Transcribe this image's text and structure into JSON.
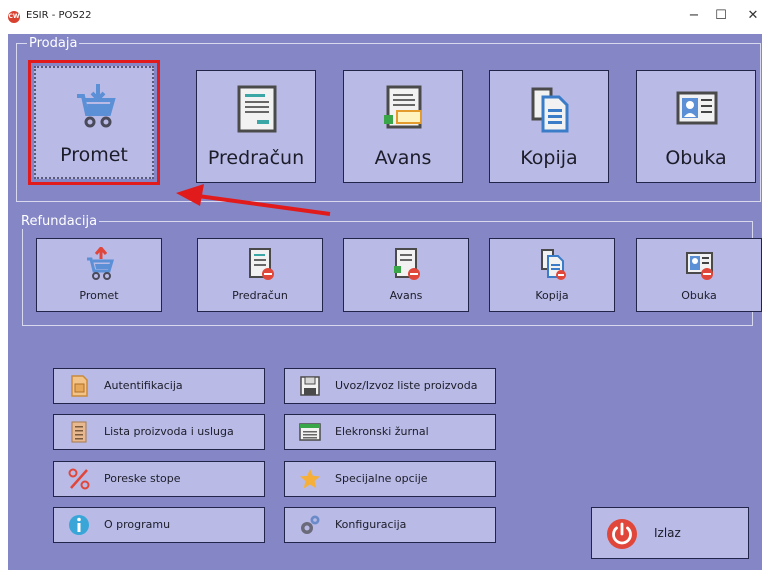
{
  "window": {
    "title": "ESIR - POS22",
    "logo_text": "CW",
    "minimize": "−",
    "maximize": "☐",
    "close": "✕"
  },
  "prodaja": {
    "legend": "Prodaja",
    "buttons": [
      {
        "label": "Promet",
        "icon": "cart-icon"
      },
      {
        "label": "Predračun",
        "icon": "invoice-icon"
      },
      {
        "label": "Avans",
        "icon": "advance-icon"
      },
      {
        "label": "Kopija",
        "icon": "copy-icon"
      },
      {
        "label": "Obuka",
        "icon": "training-icon"
      }
    ]
  },
  "refundacija": {
    "legend": "Refundacija",
    "buttons": [
      {
        "label": "Promet",
        "icon": "cart-refund-icon"
      },
      {
        "label": "Predračun",
        "icon": "invoice-refund-icon"
      },
      {
        "label": "Avans",
        "icon": "advance-refund-icon"
      },
      {
        "label": "Kopija",
        "icon": "copy-refund-icon"
      },
      {
        "label": "Obuka",
        "icon": "training-refund-icon"
      }
    ]
  },
  "options": {
    "left": [
      {
        "label": "Autentifikacija",
        "icon": "sim-card-icon"
      },
      {
        "label": "Lista proizvoda i usluga",
        "icon": "list-icon"
      },
      {
        "label": "Poreske stope",
        "icon": "percent-icon"
      },
      {
        "label": "O programu",
        "icon": "info-icon"
      }
    ],
    "right": [
      {
        "label": "Uvoz/Izvoz liste proizvoda",
        "icon": "floppy-icon"
      },
      {
        "label": "Elekronski žurnal",
        "icon": "journal-icon"
      },
      {
        "label": "Specijalne opcije",
        "icon": "star-icon"
      },
      {
        "label": "Konfiguracija",
        "icon": "gears-icon"
      }
    ]
  },
  "exit": {
    "label": "Izlaz",
    "icon": "power-icon"
  },
  "colors": {
    "background": "#8486c6",
    "button": "#b9bbe6",
    "highlight": "#e11b1b",
    "icon_blue": "#3a7cc8",
    "icon_red": "#e0463a"
  }
}
